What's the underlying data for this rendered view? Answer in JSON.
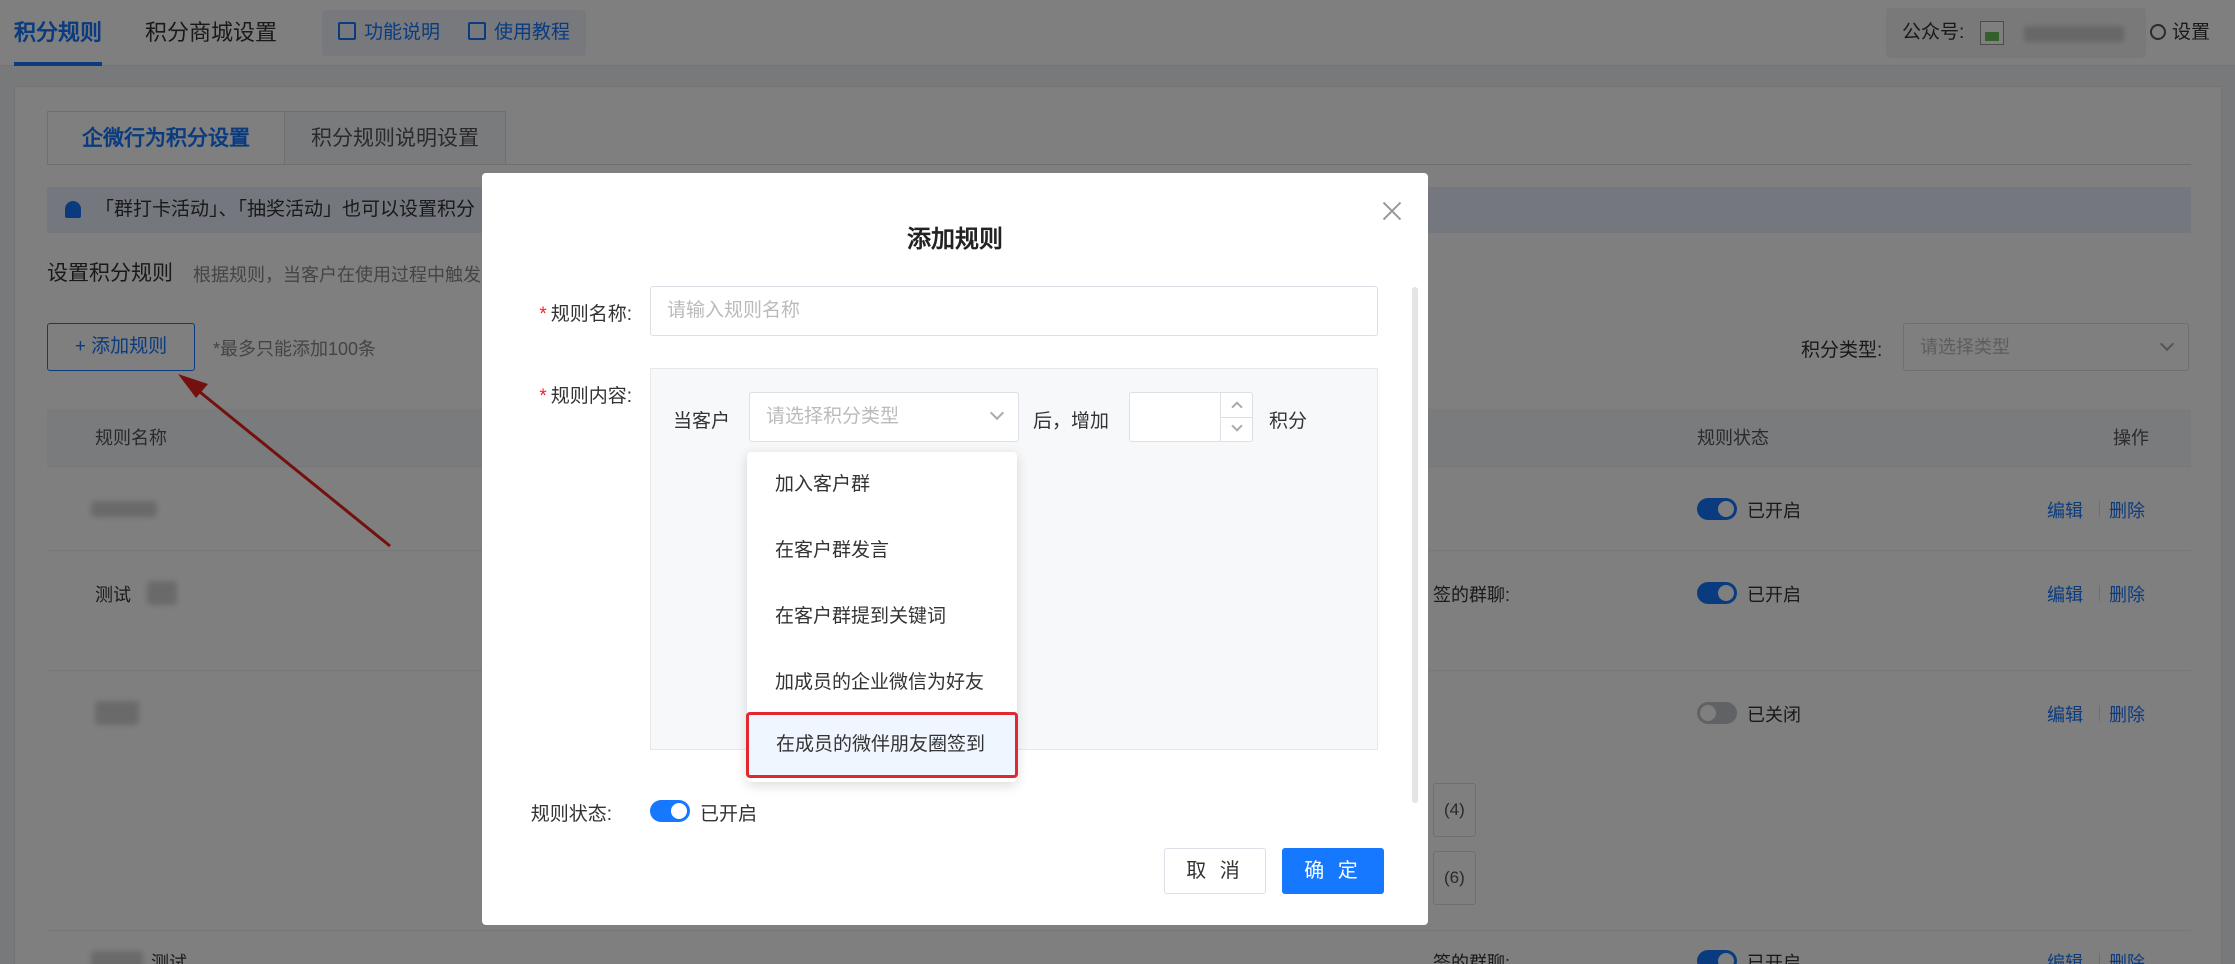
{
  "topbar": {
    "tabs": [
      {
        "label": "积分规则",
        "active": true
      },
      {
        "label": "积分商城设置",
        "active": false
      }
    ],
    "help_links": [
      {
        "label": "功能说明",
        "icon": "book-icon"
      },
      {
        "label": "使用教程",
        "icon": "document-icon"
      }
    ],
    "account_label": "公众号:",
    "settings_label": "设置"
  },
  "page": {
    "subtabs": [
      {
        "label": "企微行为积分设置",
        "active": true
      },
      {
        "label": "积分规则说明设置",
        "active": false
      }
    ],
    "notice": "「群打卡活动」、「抽奖活动」也可以设置积分",
    "section_title": "设置积分规则",
    "section_desc": "根据规则，当客户在使用过程中触发",
    "add_button": "+ 添加规则",
    "max_note": "*最多只能添加100条",
    "type_filter_label": "积分类型:",
    "type_filter_placeholder": "请选择类型",
    "table": {
      "headers": [
        "规则名称",
        "规则状态",
        "操作"
      ],
      "rows": [
        {
          "name": "",
          "status": "已开启",
          "on": true,
          "detail": ""
        },
        {
          "name": "测试",
          "status": "已开启",
          "on": true,
          "detail": "签的群聊:"
        },
        {
          "name": "",
          "status": "已关闭",
          "on": false,
          "detail": "",
          "chips": [
            "(4)",
            "(6)"
          ]
        },
        {
          "name": "测试",
          "status": "已开启",
          "on": true,
          "detail": "签的群聊:"
        }
      ],
      "edit_label": "编辑",
      "delete_label": "删除"
    }
  },
  "modal": {
    "title": "添加规则",
    "name_label": "规则名称:",
    "name_placeholder": "请输入规则名称",
    "content_label": "规则内容:",
    "content_prefix": "当客户",
    "content_type_placeholder": "请选择积分类型",
    "content_mid": "后，增加",
    "content_suffix": "积分",
    "status_label": "规则状态:",
    "status_text": "已开启",
    "cancel_label": "取 消",
    "ok_label": "确 定",
    "dropdown_options": [
      "加入客户群",
      "在客户群发言",
      "在客户群提到关键词",
      "加成员的企业微信为好友",
      "在成员的微伴朋友圈签到"
    ]
  },
  "colors": {
    "primary": "#1677ff",
    "highlight_border": "#e0282e",
    "annotation_arrow": "#e8231e"
  }
}
